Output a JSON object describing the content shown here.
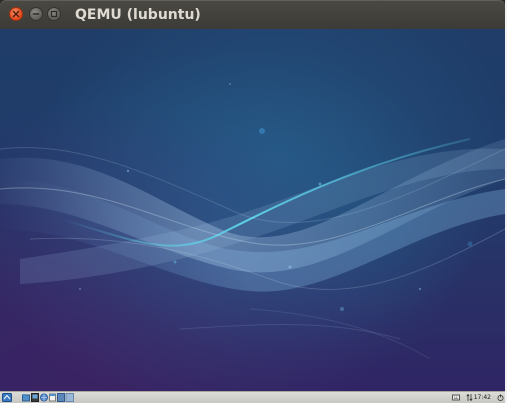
{
  "window": {
    "title": "QEMU (lubuntu)"
  },
  "titlebar_buttons": [
    "close-icon",
    "minimize-icon",
    "maximize-icon"
  ],
  "taskbar": {
    "clock": "17:42",
    "launchers": [
      "start-menu-icon",
      "file-manager-icon",
      "terminal-icon",
      "browser-icon",
      "window-list-icon",
      "desktop-icon"
    ],
    "tray_icons": [
      "keyboard-icon",
      "network-icon",
      "volume-icon",
      "power-icon"
    ]
  },
  "colors": {
    "titlebar": "#3c3b37",
    "title_text": "#dfdbd2",
    "close_button": "#e0461a",
    "wallpaper_top": "#1f3d68",
    "wallpaper_bottom": "#2f2565",
    "taskbar": "#d4d3cf"
  }
}
